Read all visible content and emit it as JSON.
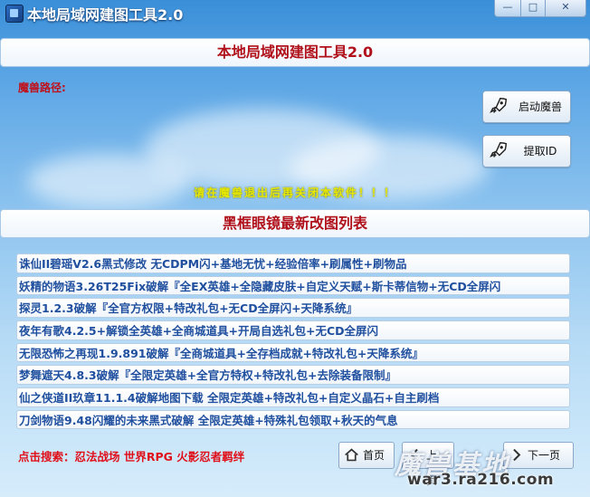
{
  "window": {
    "title": "本地局域网建图工具2.0",
    "min_label": "—",
    "max_label": "□",
    "close_label": "✕"
  },
  "header": {
    "banner": "本地局域网建图工具2.0"
  },
  "main": {
    "path_label": "魔兽路径:",
    "start_button": "启动魔兽",
    "fetch_id_button": "提取ID",
    "warning": "请在魔兽退出后再关闭本软件！！！",
    "list_title": "黑框眼镜最新改图列表"
  },
  "maps": [
    "诛仙II碧瑶V2.6黑式修改 无CDPM闪+基地无忧+经验倍率+刷属性+刷物品",
    "妖精的物语3.26T25Fix破解『全EX英雄+全隐藏皮肤+自定义天赋+斯卡蒂信物+无CD全屏闪",
    "探灵1.2.3破解『全官方权限+特改礼包+无CD全屏闪+天降系统』",
    "夜年有歌4.2.5+解锁全英雄+全商城道具+开局自选礼包+无CD全屏闪",
    "无限恐怖之再现1.9.891破解『全商城道具+全存档成就+特改礼包+天降系统』",
    "梦舞遮天4.8.3破解『全限定英雄+全官方特权+特改礼包+去除装备限制』",
    "仙之侠道II玖章11.1.4破解地图下载 全限定英雄+特改礼包+自定义晶石+自主刷档",
    "刀剑物语9.48闪耀的未来黑式破解 全限定英雄+特殊礼包领取+秋天的气息"
  ],
  "footer": {
    "search_text": "点击搜索：忍法战场 世界RPG 火影忍者羁绊",
    "home_button": "首页",
    "prev_button": "上一页",
    "next_button": "下一页"
  },
  "watermark": {
    "big": "魔兽基地",
    "small": "war3.ra216.com"
  },
  "colors": {
    "accent_red": "#b0101a",
    "link_blue": "#1f4f9e",
    "warning_yellow": "#e8e800"
  },
  "icons": {
    "start": "rocket-icon",
    "fetch": "rocket-icon",
    "home": "home-icon",
    "prev": "arrow-left-icon",
    "next": "arrow-right-icon"
  }
}
